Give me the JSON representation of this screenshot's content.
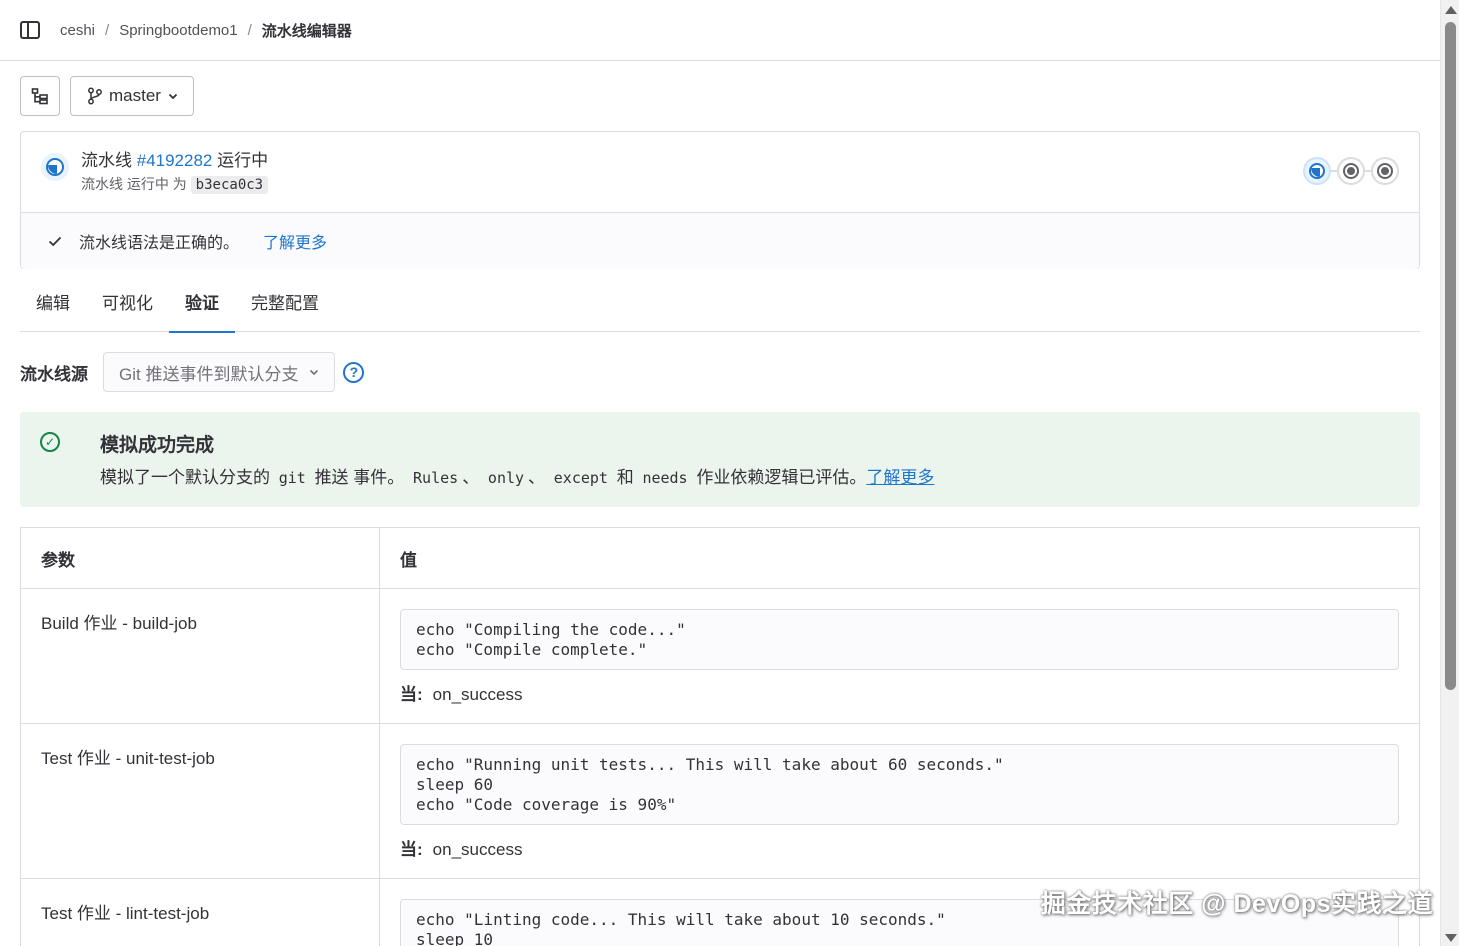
{
  "breadcrumb": {
    "items": [
      "ceshi",
      "Springbootdemo1"
    ],
    "separator": "/",
    "current": "流水线编辑器"
  },
  "toolbar": {
    "branch": "master"
  },
  "pipeline": {
    "title_prefix": "流水线",
    "id": "#4192282",
    "status": "运行中",
    "sub_prefix": "流水线 运行中 为",
    "sha": "b3eca0c3",
    "stages": [
      "running",
      "created",
      "created"
    ]
  },
  "lint": {
    "message": "流水线语法是正确的。",
    "learn_more": "了解更多"
  },
  "tabs": [
    {
      "label": "编辑",
      "active": false
    },
    {
      "label": "可视化",
      "active": false
    },
    {
      "label": "验证",
      "active": true
    },
    {
      "label": "完整配置",
      "active": false
    }
  ],
  "source": {
    "label": "流水线源",
    "selected": "Git 推送事件到默认分支",
    "help": "?"
  },
  "alert": {
    "title": "模拟成功完成",
    "text_1": "模拟了一个默认分支的",
    "code_git": "git",
    "text_2": "推送 事件。",
    "code_rules": "Rules",
    "sep_1": "、",
    "code_only": "only",
    "sep_2": "、",
    "code_except": "except",
    "text_and": "和",
    "code_needs": "needs",
    "text_3": "作业依赖逻辑已评估。",
    "link": "了解更多"
  },
  "table": {
    "headers": [
      "参数",
      "值"
    ],
    "when_label": "当:",
    "rows": [
      {
        "param": "Build 作业 - build-job",
        "script": "echo \"Compiling the code...\"\necho \"Compile complete.\"",
        "when": "on_success"
      },
      {
        "param": "Test 作业 - unit-test-job",
        "script": "echo \"Running unit tests... This will take about 60 seconds.\"\nsleep 60\necho \"Code coverage is 90%\"",
        "when": "on_success"
      },
      {
        "param": "Test 作业 - lint-test-job",
        "script": "echo \"Linting code... This will take about 10 seconds.\"\nsleep 10",
        "when": ""
      }
    ]
  },
  "watermark": "掘金技术社区 @ DevOps实践之道",
  "colors": {
    "accent": "#1f75cb",
    "success": "#108548",
    "success_bg": "#ecf4ee",
    "border": "#dcdcde"
  }
}
